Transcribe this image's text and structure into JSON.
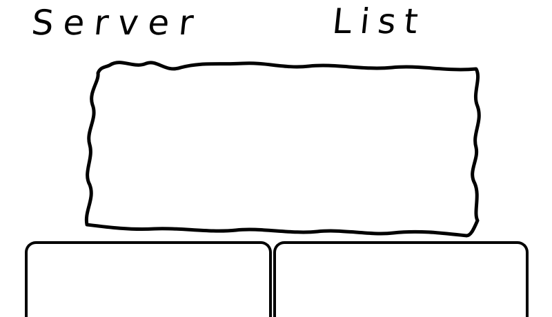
{
  "title": {
    "word1": "Server",
    "word2": "List"
  },
  "server_list": {
    "items": []
  },
  "buttons": {
    "left_label": "",
    "right_label": ""
  },
  "colors": {
    "stroke": "#000000",
    "background": "#ffffff"
  }
}
